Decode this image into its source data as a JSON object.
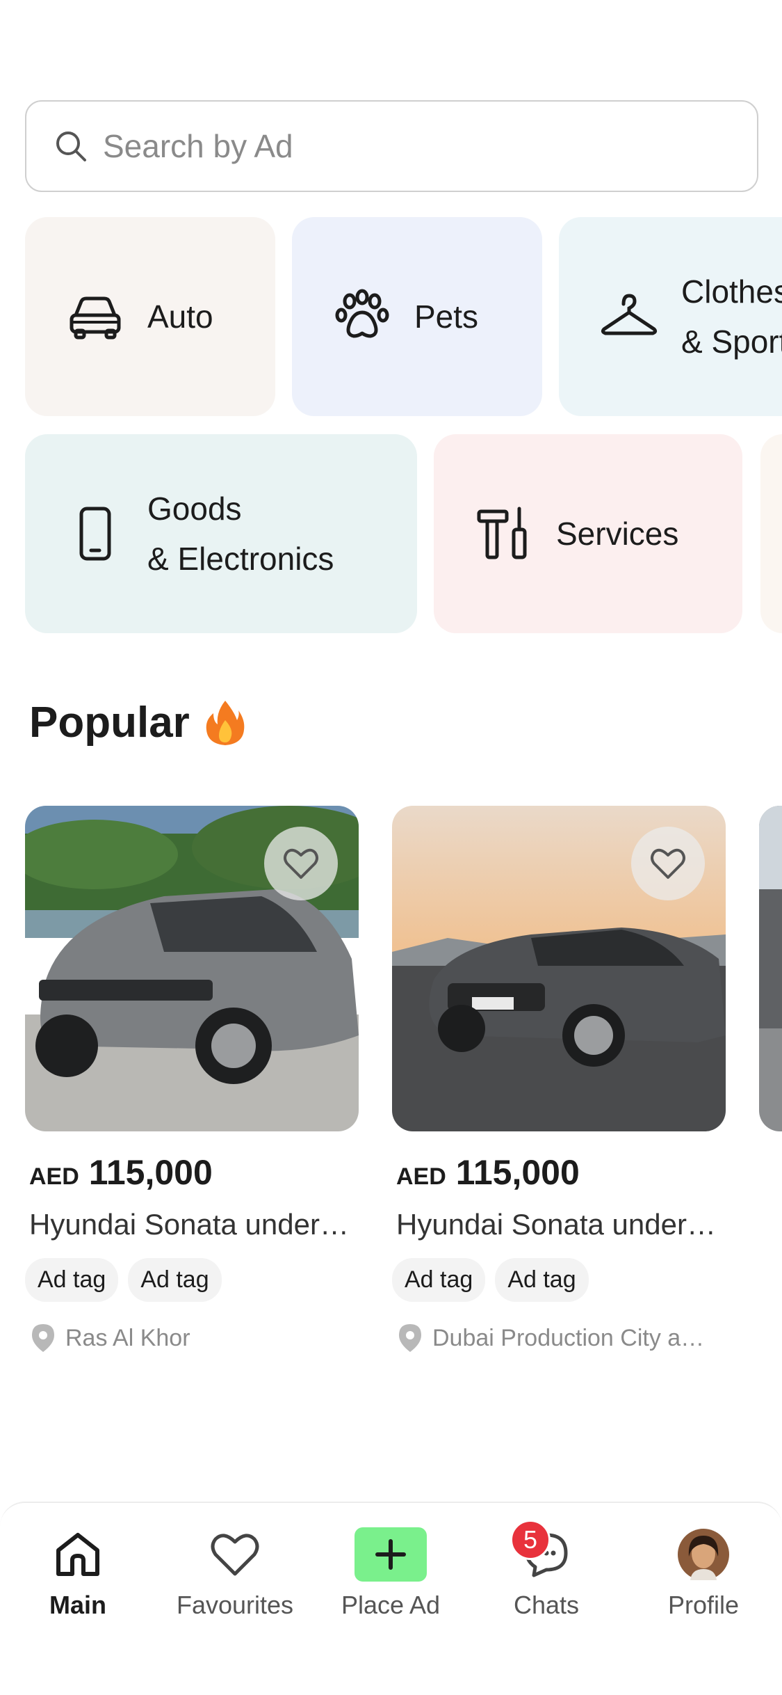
{
  "search": {
    "placeholder": "Search by Ad",
    "icon": "search-icon"
  },
  "categories": [
    {
      "label": "Auto",
      "icon": "car-icon",
      "bg": "#f8f4f1"
    },
    {
      "label": "Pets",
      "icon": "paw-icon",
      "bg": "#edf1fb"
    },
    {
      "label": "Clothes\n& Sport",
      "icon": "hanger-icon",
      "bg": "#ecf5f8"
    },
    {
      "label": "Goods\n& Electronics",
      "icon": "phone-icon",
      "bg": "#e9f3f3"
    },
    {
      "label": "Services",
      "icon": "tools-icon",
      "bg": "#fcefef"
    }
  ],
  "popular": {
    "title": "Popular",
    "icon": "fire-icon"
  },
  "ads": [
    {
      "currency": "AED",
      "price": "115,000",
      "title": "Hyundai Sonata under…",
      "tags": [
        "Ad tag",
        "Ad tag"
      ],
      "location": "Ras Al Khor"
    },
    {
      "currency": "AED",
      "price": "115,000",
      "title": "Hyundai Sonata under…",
      "tags": [
        "Ad tag",
        "Ad tag"
      ],
      "location": "Dubai Production City a…"
    }
  ],
  "nav": {
    "items": [
      {
        "label": "Main",
        "icon": "home-icon",
        "active": true
      },
      {
        "label": "Favourites",
        "icon": "heart-icon"
      },
      {
        "label": "Place Ad",
        "icon": "plus-icon"
      },
      {
        "label": "Chats",
        "icon": "chat-icon",
        "badge": "5"
      },
      {
        "label": "Profile",
        "icon": "avatar"
      }
    ]
  },
  "colors": {
    "accent_green": "#7af08c",
    "badge_red": "#e8323c"
  }
}
